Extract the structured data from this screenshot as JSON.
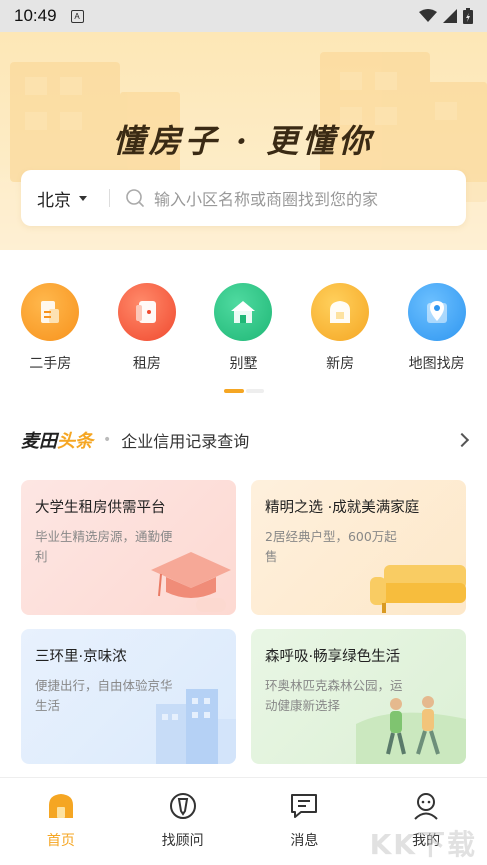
{
  "status_bar": {
    "time": "10:49",
    "sim_letter": "A"
  },
  "hero": {
    "slogan": "懂房子 · 更懂你",
    "city": "北京",
    "search_placeholder": "输入小区名称或商圈找到您的家"
  },
  "categories": [
    {
      "label": "二手房",
      "icon": "second-hand-house-icon",
      "color": "#f79a1e"
    },
    {
      "label": "租房",
      "icon": "rent-house-icon",
      "color": "#f2593c"
    },
    {
      "label": "别墅",
      "icon": "villa-icon",
      "color": "#27c184"
    },
    {
      "label": "新房",
      "icon": "new-house-icon",
      "color": "#f7b733"
    },
    {
      "label": "地图找房",
      "icon": "map-pin-icon",
      "color": "#3aa1f3"
    }
  ],
  "headlines": {
    "brand_part1": "麦田",
    "brand_part2": "头条",
    "text": "企业信用记录查询"
  },
  "cards": [
    {
      "title": "大学生租房供需平台",
      "subtitle": "毕业生精选房源，通勤便利"
    },
    {
      "title": "精明之选 ·成就美满家庭",
      "subtitle": "2居经典户型，600万起售"
    },
    {
      "title": "三环里·京味浓",
      "subtitle": "便捷出行，自由体验京华生活"
    },
    {
      "title": "森呼吸·畅享绿色生活",
      "subtitle": "环奥林匹克森林公园，运动健康新选择"
    }
  ],
  "tabs": [
    {
      "label": "首页",
      "active": true
    },
    {
      "label": "找顾问",
      "active": false
    },
    {
      "label": "消息",
      "active": false
    },
    {
      "label": "我的",
      "active": false
    }
  ],
  "watermark": "KK下载",
  "colors": {
    "accent": "#f5a623",
    "hero_bg": "#fde7b6"
  }
}
